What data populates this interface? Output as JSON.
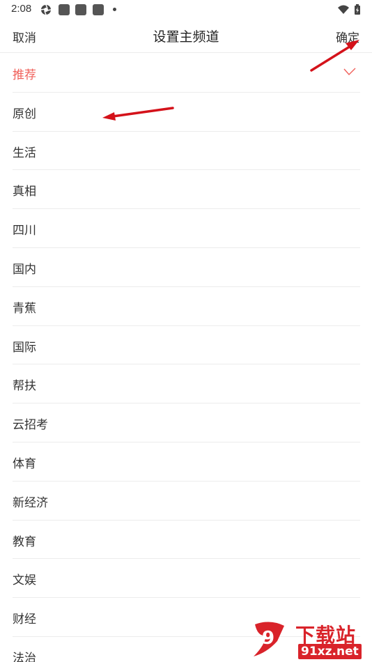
{
  "status_bar": {
    "time": "2:08"
  },
  "nav": {
    "cancel_label": "取消",
    "title": "设置主频道",
    "confirm_label": "确定"
  },
  "channels": [
    {
      "label": "推荐",
      "selected": true
    },
    {
      "label": "原创"
    },
    {
      "label": "生活"
    },
    {
      "label": "真相"
    },
    {
      "label": "四川"
    },
    {
      "label": "国内"
    },
    {
      "label": "青蕉"
    },
    {
      "label": "国际"
    },
    {
      "label": "帮扶"
    },
    {
      "label": "云招考"
    },
    {
      "label": "体育"
    },
    {
      "label": "新经济"
    },
    {
      "label": "教育"
    },
    {
      "label": "文娱"
    },
    {
      "label": "财经"
    },
    {
      "label": "法治"
    }
  ],
  "colors": {
    "accent": "#f0605a",
    "annotation_arrow": "#d4121a",
    "watermark": "#d9232a"
  },
  "watermark": {
    "logo_text": "9",
    "title": "下载站",
    "site": "91xz.net"
  }
}
